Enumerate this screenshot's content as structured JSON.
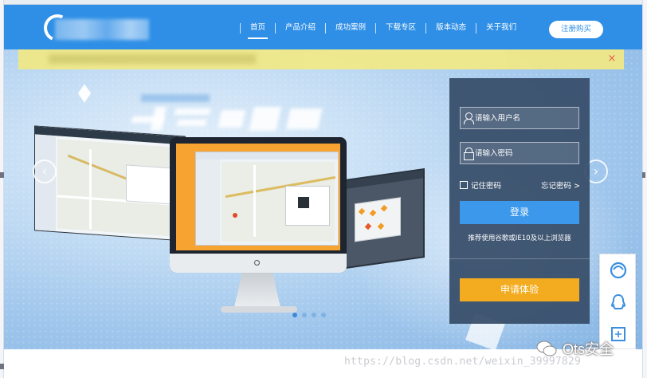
{
  "nav": {
    "items": [
      "首页",
      "产品介绍",
      "成功案例",
      "下载专区",
      "版本动态",
      "关于我们"
    ],
    "active_index": 0,
    "register_label": "注册购买"
  },
  "notice": {
    "close_glyph": "×"
  },
  "slider": {
    "prev_glyph": "‹",
    "next_glyph": "›",
    "dot_count": 4,
    "active_dot": 0
  },
  "login": {
    "username_placeholder": "请输入用户名",
    "password_placeholder": "请输入密码",
    "remember_label": "记住密码",
    "forgot_label": "忘记密码 >",
    "login_button": "登录",
    "browser_tip": "推荐使用谷歌或IE10及以上浏览器",
    "trial_button": "申请体验"
  },
  "side_tools": {
    "icons": [
      "support-icon",
      "qq-icon",
      "scan-icon"
    ]
  },
  "watermark": {
    "url": "https://blog.csdn.net/weixin_39997829",
    "badge": "Ots安全"
  },
  "colors": {
    "header_blue": "#2f8fe6",
    "login_button": "#3b98ea",
    "trial_button": "#f3ac1f",
    "login_panel": "#364c68",
    "notice_bar": "#efe889"
  }
}
